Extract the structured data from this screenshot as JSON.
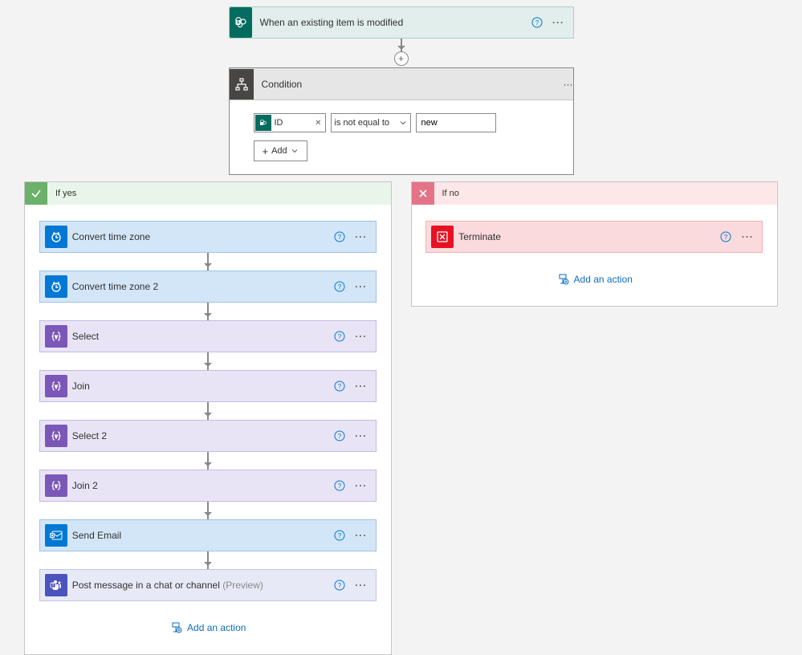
{
  "trigger": {
    "title": "When an existing item is modified"
  },
  "condition": {
    "title": "Condition",
    "token": "ID",
    "operator": "is not equal to",
    "value": "new",
    "add_label": "Add"
  },
  "branches": {
    "yes": {
      "label": "If yes",
      "actions": [
        {
          "type": "blue",
          "icon": "clock",
          "title": "Convert time zone",
          "suffix": ""
        },
        {
          "type": "blue",
          "icon": "clock",
          "title": "Convert time zone 2",
          "suffix": ""
        },
        {
          "type": "purple",
          "icon": "braces",
          "title": "Select",
          "suffix": ""
        },
        {
          "type": "purple",
          "icon": "braces",
          "title": "Join",
          "suffix": ""
        },
        {
          "type": "purple",
          "icon": "braces",
          "title": "Select 2",
          "suffix": ""
        },
        {
          "type": "purple",
          "icon": "braces",
          "title": "Join 2",
          "suffix": ""
        },
        {
          "type": "outlook",
          "icon": "mail",
          "title": "Send Email",
          "suffix": ""
        },
        {
          "type": "teams",
          "icon": "teams",
          "title": "Post message in a chat or channel ",
          "suffix": "(Preview)"
        }
      ],
      "add_action": "Add an action"
    },
    "no": {
      "label": "If no",
      "actions": [
        {
          "type": "red",
          "icon": "terminate",
          "title": "Terminate",
          "suffix": ""
        }
      ],
      "add_action": "Add an action"
    }
  }
}
